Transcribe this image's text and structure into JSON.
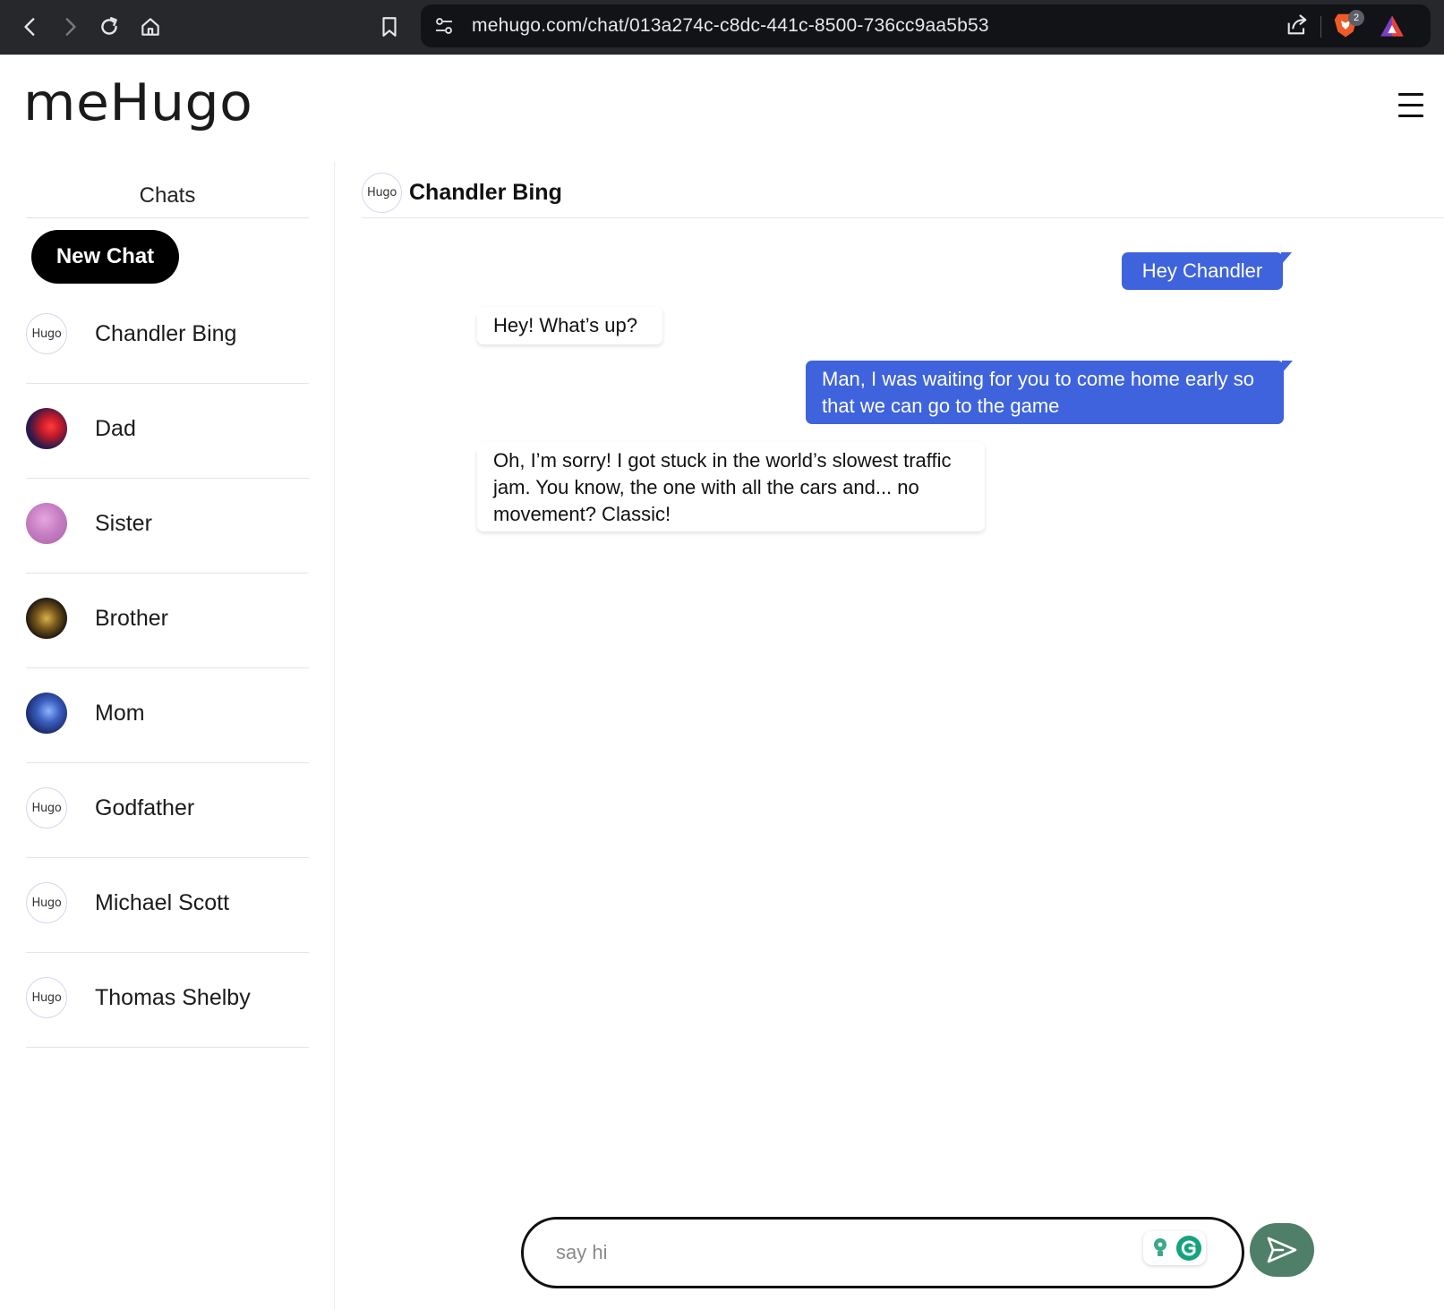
{
  "browser": {
    "url": "mehugo.com/chat/013a274c-c8dc-441c-8500-736cc9aa5b53",
    "badge_count": "2"
  },
  "app": {
    "logo": "meHugo"
  },
  "sidebar": {
    "title": "Chats",
    "new_chat_label": "New Chat",
    "avatar_text": "Hugo",
    "items": [
      {
        "name": "Chandler Bing",
        "avatar": "hugo"
      },
      {
        "name": "Dad",
        "avatar": "red-blue-image"
      },
      {
        "name": "Sister",
        "avatar": "purple-fur-image"
      },
      {
        "name": "Brother",
        "avatar": "dark-gold-image"
      },
      {
        "name": "Mom",
        "avatar": "blue-space-image"
      },
      {
        "name": "Godfather",
        "avatar": "hugo"
      },
      {
        "name": "Michael Scott",
        "avatar": "hugo"
      },
      {
        "name": "Thomas Shelby",
        "avatar": "hugo"
      }
    ]
  },
  "chat": {
    "header_name": "Chandler Bing",
    "avatar_text": "Hugo",
    "messages": [
      {
        "role": "user",
        "text": "Hey Chandler"
      },
      {
        "role": "bot",
        "text": "Hey! What’s up?"
      },
      {
        "role": "user",
        "text": "Man, I was waiting for you to come home early so that we can go to the game"
      },
      {
        "role": "bot",
        "text": "Oh, I’m sorry! I got stuck in the world’s slowest traffic jam. You know, the one with all the cars and... no movement? Classic!"
      }
    ]
  },
  "composer": {
    "placeholder": "say hi",
    "value": ""
  },
  "colors": {
    "user_bubble": "#3e63dd",
    "send_button": "#4f7f69",
    "browser_bar": "#27282c"
  }
}
